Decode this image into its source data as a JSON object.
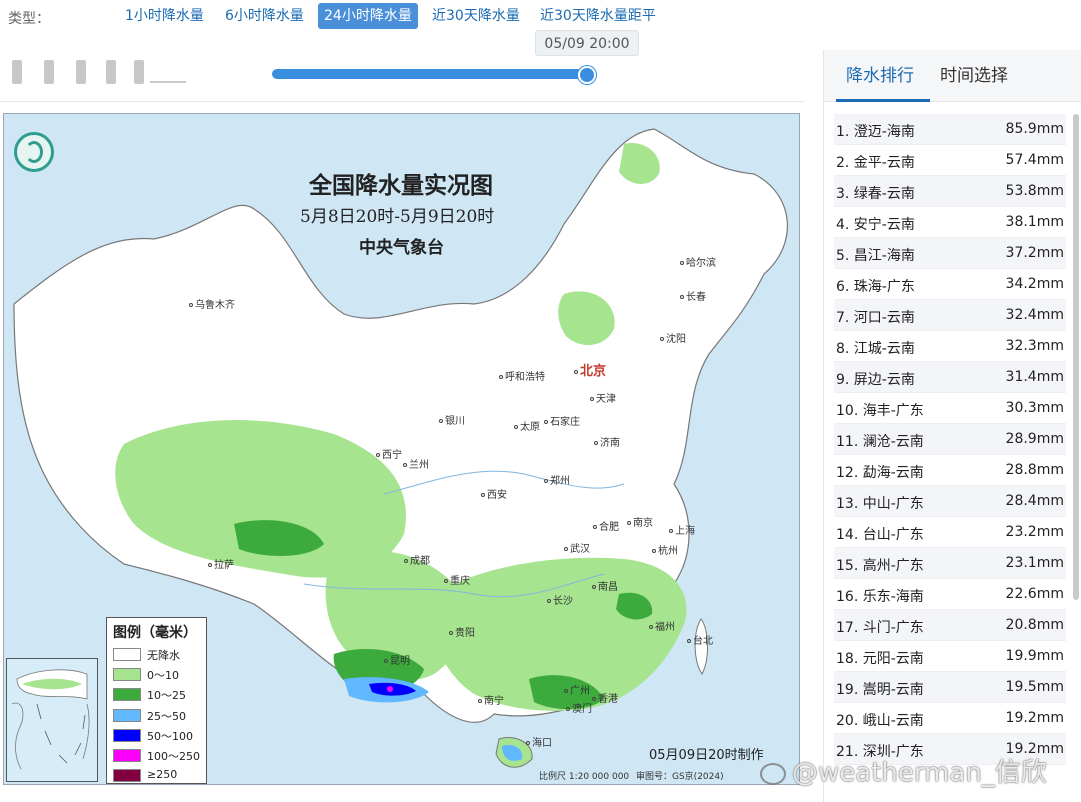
{
  "type_bar": {
    "label": "类型：",
    "tabs": [
      {
        "label": "1小时降水量",
        "active": false
      },
      {
        "label": "6小时降水量",
        "active": false
      },
      {
        "label": "24小时降水量",
        "active": true
      },
      {
        "label": "近30天降水量",
        "active": false
      },
      {
        "label": "近30天降水量距平",
        "active": false
      }
    ]
  },
  "time_slider": {
    "current": "05/09 20:00",
    "progress_fraction": 1.0
  },
  "map": {
    "title": "全国降水量实况图",
    "subtitle": "5月8日20时-5月9日20时",
    "agency": "中央气象台",
    "made_note": "05月09日20时制作",
    "scale": "比例尺 1:20 000 000",
    "approval": "审图号：GS京(2024)",
    "capital": "北京",
    "cities": [
      "乌鲁木齐",
      "哈尔滨",
      "长春",
      "沈阳",
      "呼和浩特",
      "天津",
      "银川",
      "太原",
      "石家庄",
      "济南",
      "西宁",
      "兰州",
      "郑州",
      "西安",
      "合肥",
      "南京",
      "上海",
      "成都",
      "武汉",
      "杭州",
      "拉萨",
      "重庆",
      "长沙",
      "南昌",
      "福州",
      "贵阳",
      "台北",
      "昆明",
      "南宁",
      "广州",
      "澳门",
      "香港",
      "海口"
    ],
    "legend": {
      "title": "图例（毫米）",
      "items": [
        {
          "label": "无降水",
          "color": "#ffffff"
        },
        {
          "label": "0～10",
          "color": "#a6e48f"
        },
        {
          "label": "10～25",
          "color": "#3caa3c"
        },
        {
          "label": "25～50",
          "color": "#61b8ff"
        },
        {
          "label": "50～100",
          "color": "#0000ff"
        },
        {
          "label": "100～250",
          "color": "#fa00fa"
        },
        {
          "label": "≥250",
          "color": "#800040"
        }
      ]
    }
  },
  "right_panel": {
    "tabs": [
      {
        "label": "降水排行",
        "active": true
      },
      {
        "label": "时间选择",
        "active": false
      }
    ],
    "ranking": [
      {
        "name": "1. 澄迈-海南",
        "value": "85.9mm"
      },
      {
        "name": "2. 金平-云南",
        "value": "57.4mm"
      },
      {
        "name": "3. 绿春-云南",
        "value": "53.8mm"
      },
      {
        "name": "4. 安宁-云南",
        "value": "38.1mm"
      },
      {
        "name": "5. 昌江-海南",
        "value": "37.2mm"
      },
      {
        "name": "6. 珠海-广东",
        "value": "34.2mm"
      },
      {
        "name": "7. 河口-云南",
        "value": "32.4mm"
      },
      {
        "name": "8. 江城-云南",
        "value": "32.3mm"
      },
      {
        "name": "9. 屏边-云南",
        "value": "31.4mm"
      },
      {
        "name": "10. 海丰-广东",
        "value": "30.3mm"
      },
      {
        "name": "11. 澜沧-云南",
        "value": "28.9mm"
      },
      {
        "name": "12. 勐海-云南",
        "value": "28.8mm"
      },
      {
        "name": "13. 中山-广东",
        "value": "28.4mm"
      },
      {
        "name": "14. 台山-广东",
        "value": "23.2mm"
      },
      {
        "name": "15. 高州-广东",
        "value": "23.1mm"
      },
      {
        "name": "16. 乐东-海南",
        "value": "22.6mm"
      },
      {
        "name": "17. 斗门-广东",
        "value": "20.8mm"
      },
      {
        "name": "18. 元阳-云南",
        "value": "19.9mm"
      },
      {
        "name": "19. 嵩明-云南",
        "value": "19.5mm"
      },
      {
        "name": "20. 峨山-云南",
        "value": "19.2mm"
      },
      {
        "name": "21. 深圳-广东",
        "value": "19.2mm"
      }
    ]
  },
  "watermark": "@weatherman_信欣"
}
